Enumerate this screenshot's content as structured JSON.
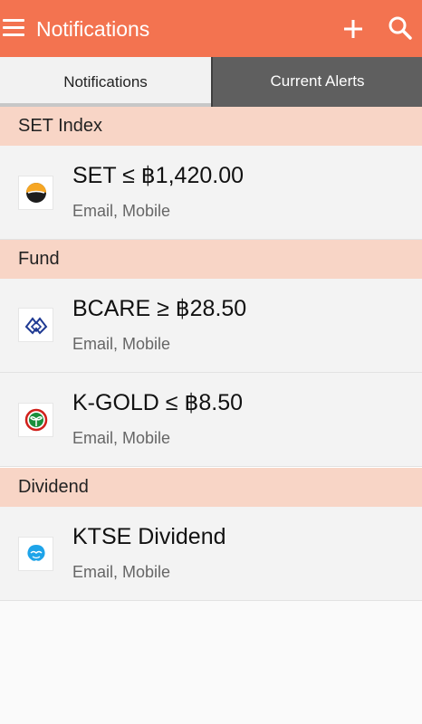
{
  "appbar": {
    "title": "Notifications",
    "color": "#f37350",
    "icons": [
      "hamburger-menu-icon",
      "plus-icon",
      "search-icon"
    ]
  },
  "tabs": [
    {
      "label": "Notifications",
      "active": true
    },
    {
      "label": "Current Alerts",
      "active": false
    }
  ],
  "sections": [
    {
      "header": "SET Index",
      "items": [
        {
          "title": "SET ≤ ฿1,420.00",
          "subtitle": "Email, Mobile",
          "logo": "set-logo-icon"
        }
      ]
    },
    {
      "header": "Fund",
      "items": [
        {
          "title": "BCARE ≥ ฿28.50",
          "subtitle": "Email, Mobile",
          "logo": "bcare-fund-logo-icon"
        },
        {
          "title": "K-GOLD ≤ ฿8.50",
          "subtitle": "Email, Mobile",
          "logo": "kasikorn-logo-icon"
        }
      ]
    },
    {
      "header": "Dividend",
      "items": [
        {
          "title": "KTSE Dividend",
          "subtitle": "Email, Mobile",
          "logo": "ktb-logo-icon"
        }
      ]
    }
  ]
}
